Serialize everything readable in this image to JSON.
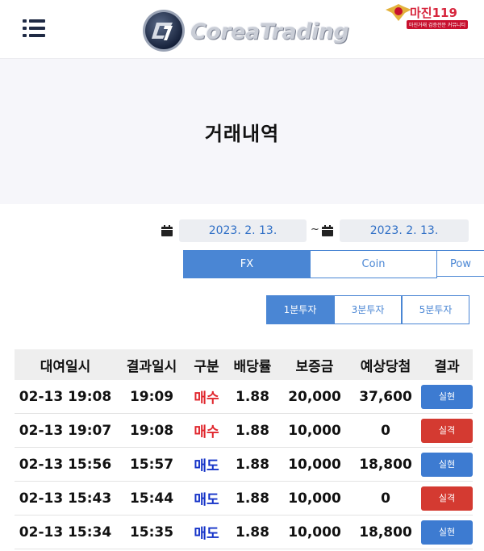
{
  "header": {
    "logo_text": "CoreaTrading",
    "badge_title": "마진119",
    "badge_subtitle": "마진거래 검증전문 커뮤니티"
  },
  "page": {
    "title": "거래내역"
  },
  "date_filter": {
    "start_date": "2023. 2. 13.",
    "separator": "~",
    "end_date": "2023. 2. 13."
  },
  "market_tabs": [
    {
      "label": "FX",
      "active": true
    },
    {
      "label": "Coin",
      "active": false
    },
    {
      "label": "Pow",
      "active": false
    }
  ],
  "duration_tabs": [
    {
      "label": "1분투자",
      "active": true
    },
    {
      "label": "3분투자",
      "active": false
    },
    {
      "label": "5분투자",
      "active": false
    }
  ],
  "table": {
    "headers": [
      "대여일시",
      "결과일시",
      "구분",
      "배당률",
      "보증금",
      "예상당첨",
      "결과"
    ],
    "rows": [
      {
        "start": "02-13 19:08",
        "end": "19:09",
        "type": "매수",
        "type_kind": "buy",
        "rate": "1.88",
        "deposit": "20,000",
        "expected": "37,600",
        "result": "실현",
        "result_kind": "win"
      },
      {
        "start": "02-13 19:07",
        "end": "19:08",
        "type": "매수",
        "type_kind": "buy",
        "rate": "1.88",
        "deposit": "10,000",
        "expected": "0",
        "result": "실격",
        "result_kind": "lose"
      },
      {
        "start": "02-13 15:56",
        "end": "15:57",
        "type": "매도",
        "type_kind": "sell",
        "rate": "1.88",
        "deposit": "10,000",
        "expected": "18,800",
        "result": "실현",
        "result_kind": "win"
      },
      {
        "start": "02-13 15:43",
        "end": "15:44",
        "type": "매도",
        "type_kind": "sell",
        "rate": "1.88",
        "deposit": "10,000",
        "expected": "0",
        "result": "실격",
        "result_kind": "lose"
      },
      {
        "start": "02-13 15:34",
        "end": "15:35",
        "type": "매도",
        "type_kind": "sell",
        "rate": "1.88",
        "deposit": "10,000",
        "expected": "18,800",
        "result": "실현",
        "result_kind": "win"
      }
    ]
  },
  "colors": {
    "accent": "#4a86d4",
    "buy": "#e0262d",
    "sell": "#1533c8",
    "win": "#3d7bd1",
    "lose": "#d43a31"
  }
}
